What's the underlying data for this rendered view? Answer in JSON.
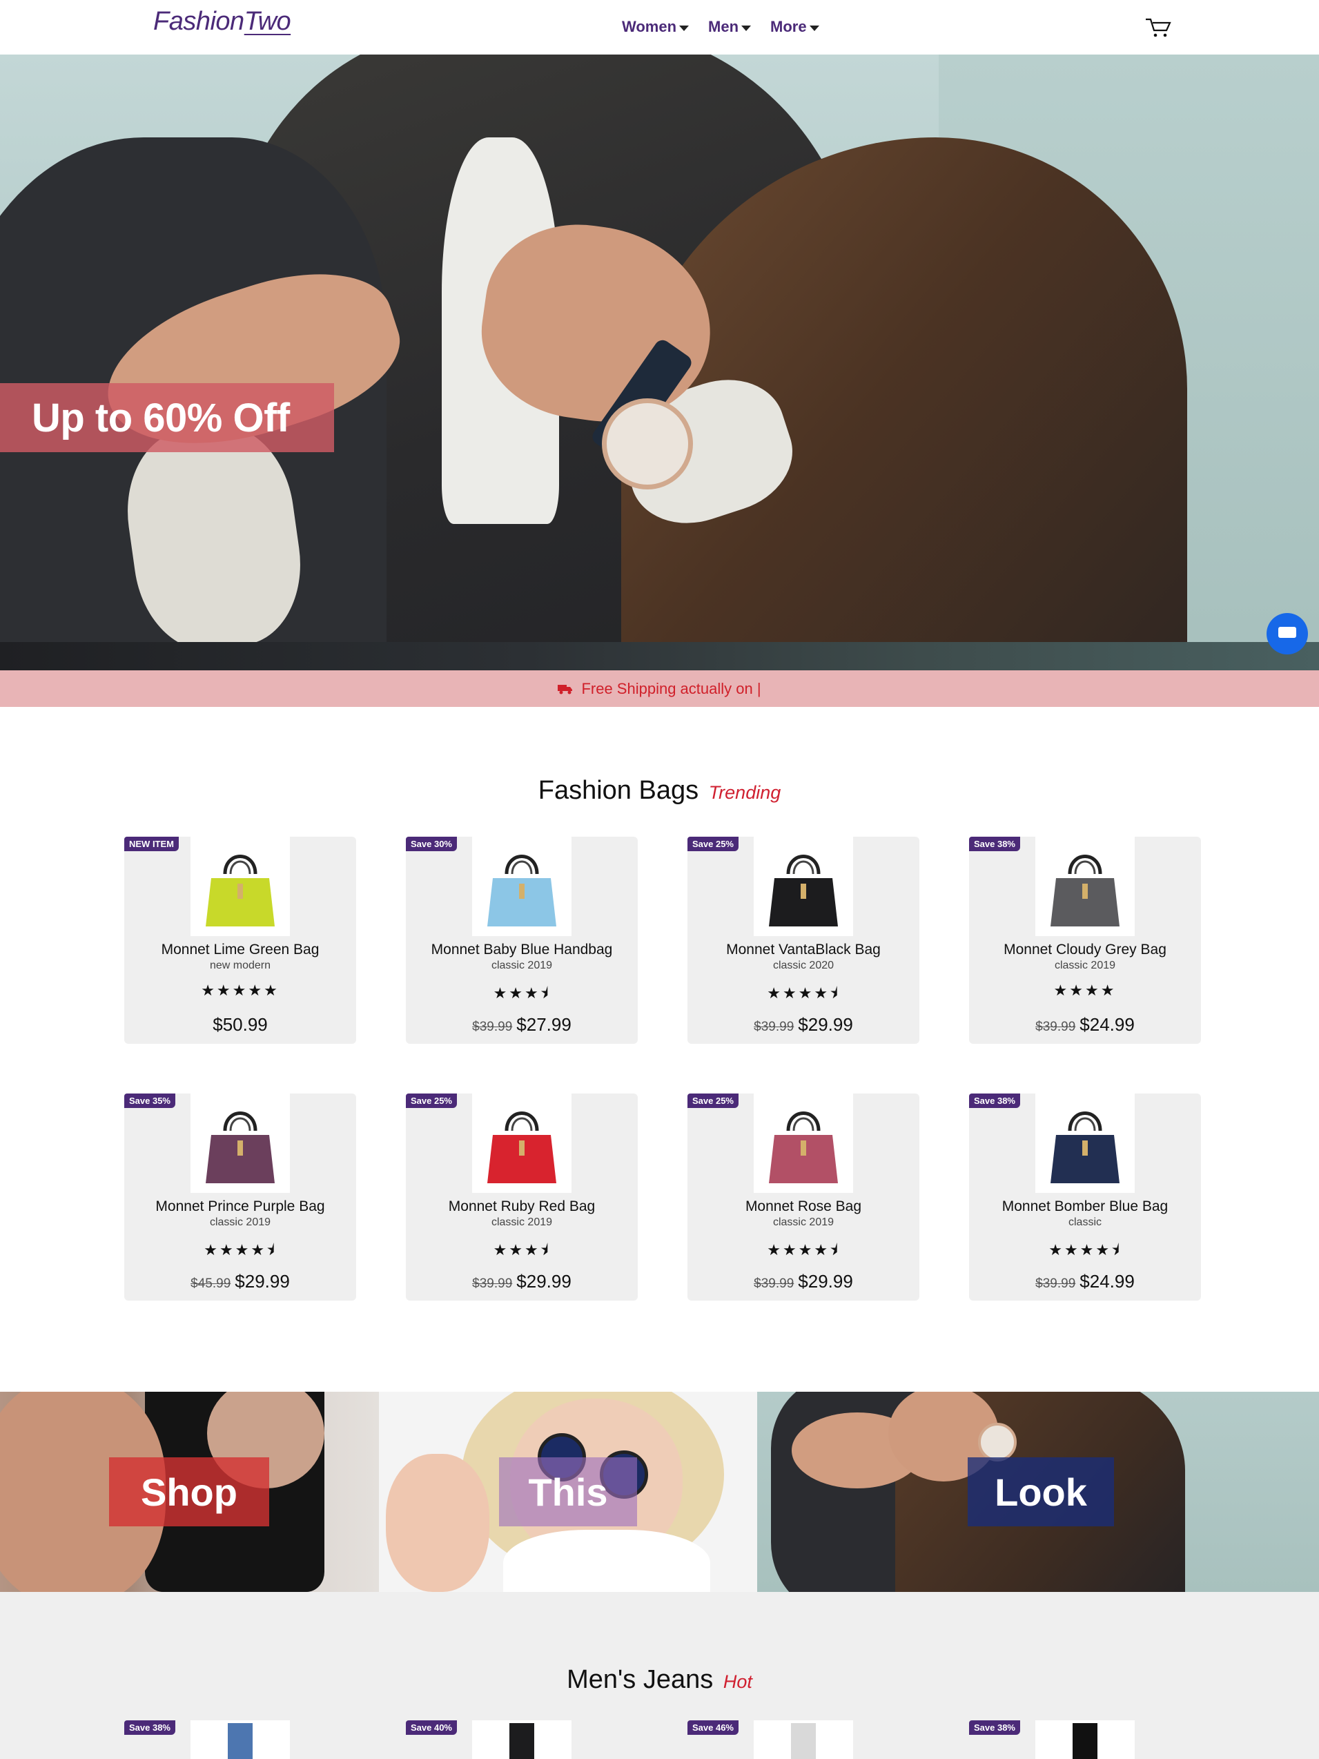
{
  "header": {
    "logo_part1": "Fashion",
    "logo_part2": "Two",
    "nav": [
      "Women",
      "Men",
      "More"
    ]
  },
  "hero": {
    "promo": "Up to 60% Off"
  },
  "shipping": {
    "text": "Free Shipping actually on |"
  },
  "bags": {
    "title": "Fashion Bags",
    "tag": "Trending",
    "products": [
      {
        "badge": "NEW ITEM",
        "name": "Monnet Lime Green Bag",
        "sub": "new modern",
        "stars": "★★★★★",
        "rating": 5,
        "old_price": "",
        "price": "$50.99",
        "color": "#c8d92a"
      },
      {
        "badge": "Save 30%",
        "name": "Monnet Baby Blue Handbag",
        "sub": "classic 2019",
        "stars": "★★★⯨",
        "rating": 3.5,
        "old_price": "$39.99",
        "price": "$27.99",
        "color": "#8cc6e6"
      },
      {
        "badge": "Save 25%",
        "name": "Monnet VantaBlack Bag",
        "sub": "classic 2020",
        "stars": "★★★★⯨",
        "rating": 4.5,
        "old_price": "$39.99",
        "price": "$29.99",
        "color": "#1c1c1e"
      },
      {
        "badge": "Save 38%",
        "name": "Monnet Cloudy Grey Bag",
        "sub": "classic 2019",
        "stars": "★★★★",
        "rating": 4,
        "old_price": "$39.99",
        "price": "$24.99",
        "color": "#5b5b5e"
      },
      {
        "badge": "Save 35%",
        "name": "Monnet Prince Purple Bag",
        "sub": "classic 2019",
        "stars": "★★★★⯨",
        "rating": 4.5,
        "old_price": "$45.99",
        "price": "$29.99",
        "color": "#6b3f5c"
      },
      {
        "badge": "Save 25%",
        "name": "Monnet Ruby Red Bag",
        "sub": "classic 2019",
        "stars": "★★★⯨",
        "rating": 3.5,
        "old_price": "$39.99",
        "price": "$29.99",
        "color": "#d8232e"
      },
      {
        "badge": "Save 25%",
        "name": "Monnet Rose Bag",
        "sub": "classic 2019",
        "stars": "★★★★⯨",
        "rating": 4.5,
        "old_price": "$39.99",
        "price": "$29.99",
        "color": "#b25066"
      },
      {
        "badge": "Save 38%",
        "name": "Monnet Bomber Blue Bag",
        "sub": "classic",
        "stars": "★★★★⯨",
        "rating": 4.5,
        "old_price": "$39.99",
        "price": "$24.99",
        "color": "#222f52"
      }
    ]
  },
  "look": {
    "shop": "Shop",
    "this": "This",
    "look": "Look"
  },
  "jeans": {
    "title": "Men's Jeans",
    "tag": "Hot",
    "badges": [
      "Save 38%",
      "Save 40%",
      "Save 46%",
      "Save 38%"
    ]
  }
}
